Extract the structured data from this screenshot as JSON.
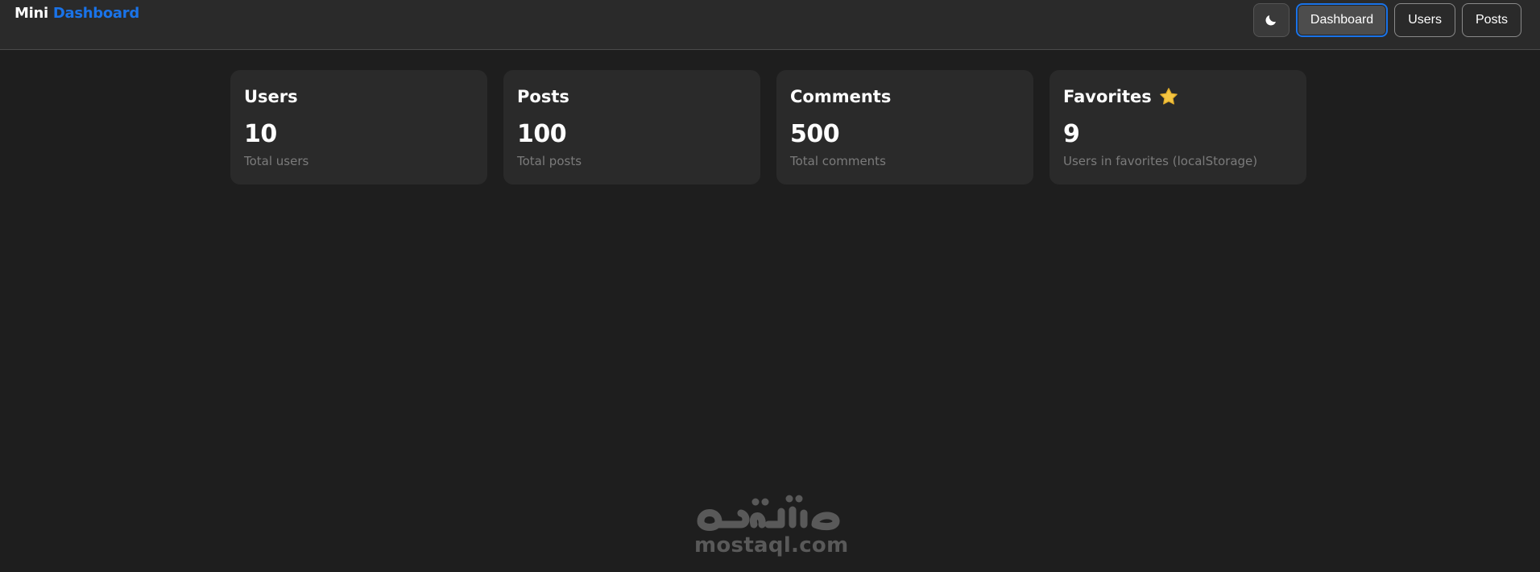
{
  "brand": {
    "part1": "Mini",
    "part2": "Dashboard"
  },
  "nav": {
    "theme_icon": "moon-icon",
    "items": [
      {
        "label": "Dashboard",
        "active": true
      },
      {
        "label": "Users",
        "active": false
      },
      {
        "label": "Posts",
        "active": false
      }
    ]
  },
  "cards": [
    {
      "title": "Users",
      "value": "10",
      "subtitle": "Total users"
    },
    {
      "title": "Posts",
      "value": "100",
      "subtitle": "Total posts"
    },
    {
      "title": "Comments",
      "value": "500",
      "subtitle": "Total comments"
    },
    {
      "title": "Favorites",
      "value": "9",
      "subtitle": "Users in favorites (localStorage)",
      "icon": "star-icon"
    }
  ],
  "watermark": {
    "text": "mostaql.com",
    "arabic": "مستقل"
  },
  "colors": {
    "accent": "#1a73e8",
    "background": "#1e1e1e",
    "card": "#2a2a2a",
    "star": "#f4c542"
  }
}
